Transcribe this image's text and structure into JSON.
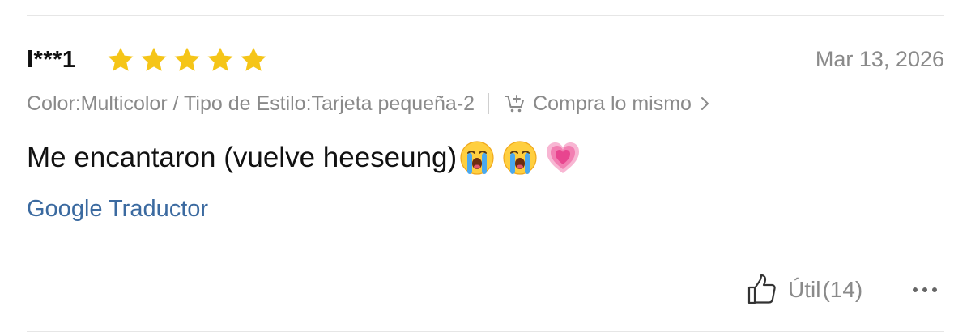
{
  "review": {
    "username": "l***1",
    "rating": 5,
    "rating_max": 5,
    "date": "Mar 13, 2026",
    "variant": "Color:Multicolor / Tipo de Estilo:Tarjeta pequeña-2",
    "buy_same_label": "Compra lo mismo",
    "text": "Me encantaron (vuelve heeseung)",
    "emojis": [
      "loudly-crying-face",
      "loudly-crying-face",
      "growing-heart"
    ],
    "translate_label": "Google Traductor",
    "helpful_label": "Útil",
    "helpful_count": "(14)"
  },
  "colors": {
    "star": "#f5c518",
    "muted_text": "#8a8a8a",
    "link": "#3b6aa0",
    "divider": "#e6e6e6"
  },
  "icons": [
    "star-icon",
    "cart-plus-icon",
    "chevron-right-icon",
    "thumbs-up-icon",
    "more-dots-icon"
  ]
}
